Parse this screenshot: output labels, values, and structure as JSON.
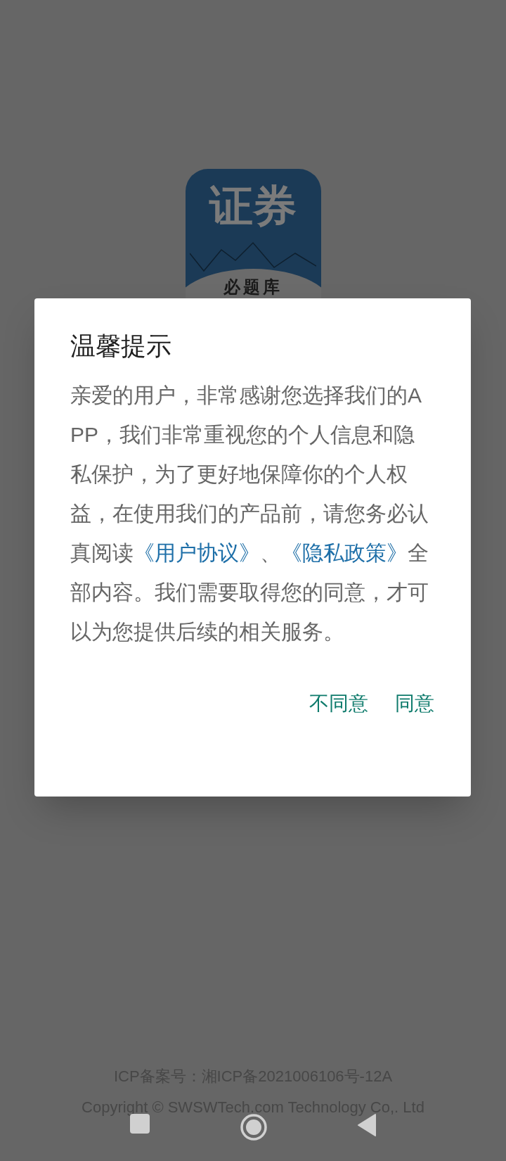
{
  "app_icon": {
    "title": "证券",
    "subtitle": "必题库"
  },
  "dialog": {
    "title": "温馨提示",
    "message": [
      {
        "kind": "text",
        "text": "亲爱的用户，非常感谢您选择我们的APP，我们非常重视您的个人信息和隐私保护，为了更好地保障你的个人权益，在使用我们的产品前，请您务必认真阅读"
      },
      {
        "kind": "link",
        "text": "《用户协议》"
      },
      {
        "kind": "text",
        "text": "、"
      },
      {
        "kind": "link",
        "text": "《隐私政策》"
      },
      {
        "kind": "text",
        "text": "全部内容。我们需要取得您的同意，才可以为您提供后续的相关服务。"
      }
    ],
    "buttons": [
      "不同意",
      "同意"
    ]
  },
  "footer": {
    "icp": "ICP备案号：湘ICP备2021006106号-12A",
    "copyright": "Copyright © SWSWTech.com Technology Co,. Ltd"
  }
}
